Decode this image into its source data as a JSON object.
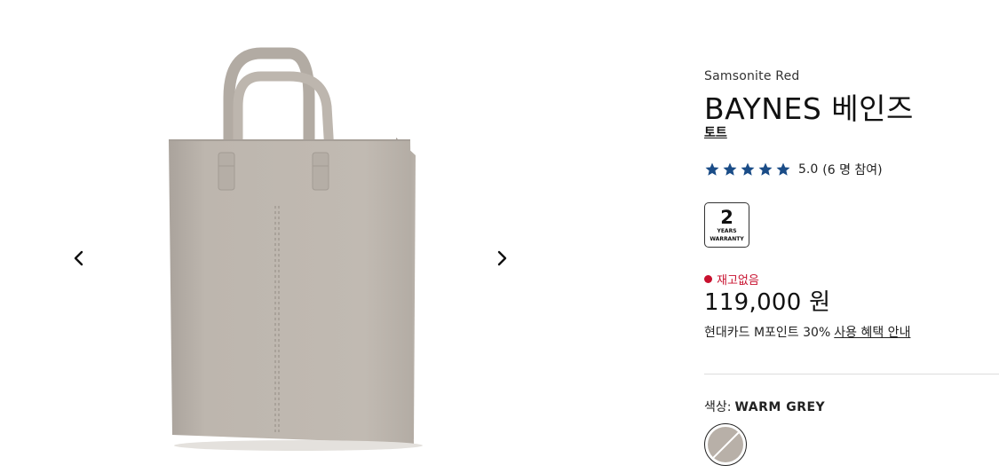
{
  "gallery": {
    "prev_icon": "chevron-left-icon",
    "next_icon": "chevron-right-icon",
    "image_alt": "product-image-tote-bag",
    "bag_color": "#bdb6ae"
  },
  "product": {
    "brand": "Samsonite Red",
    "title": "BAYNES 베인즈",
    "category": "토트",
    "rating_value": "5.0",
    "rating_count": "(6 명 참여)",
    "star_color": "#1a4c87",
    "warranty_years": "2",
    "warranty_label_1": "YEARS",
    "warranty_label_2": "WARRANTY",
    "stock_status": "재고없음",
    "stock_color": "#c8102e",
    "price": "119,000 원",
    "promo_text": "현대카드 M포인트 30%",
    "promo_link": "사용 혜택 안내",
    "color_label": "색상:",
    "color_value": "WARM GREY",
    "swatch_color": "#b8b0a8"
  }
}
